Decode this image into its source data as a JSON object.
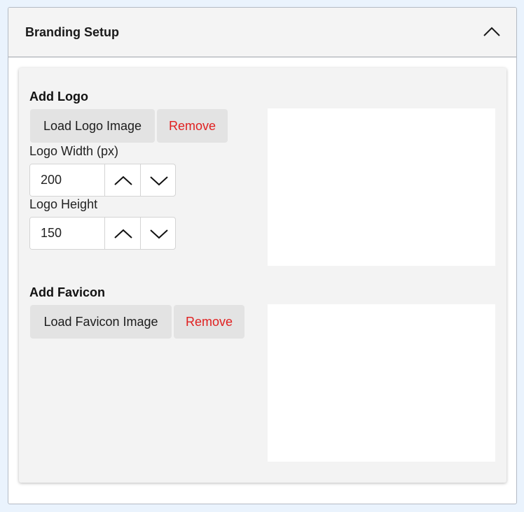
{
  "panel": {
    "title": "Branding Setup",
    "collapse_icon": "chevron-up-icon"
  },
  "logo": {
    "section_title": "Add Logo",
    "load_label": "Load Logo Image",
    "remove_label": "Remove",
    "width_label": "Logo Width (px)",
    "width_value": "200",
    "height_label": "Logo Height",
    "height_value": "150",
    "increment_icon": "chevron-up-icon",
    "decrement_icon": "chevron-down-icon"
  },
  "favicon": {
    "section_title": "Add Favicon",
    "load_label": "Load Favicon Image",
    "remove_label": "Remove"
  },
  "colors": {
    "page_background": "#eaf3fd",
    "panel_header": "#f4f4f4",
    "card_background": "#f3f3f3",
    "button_background": "#e3e3e3",
    "remove_text": "#e02020",
    "preview_background": "#ffffff"
  }
}
